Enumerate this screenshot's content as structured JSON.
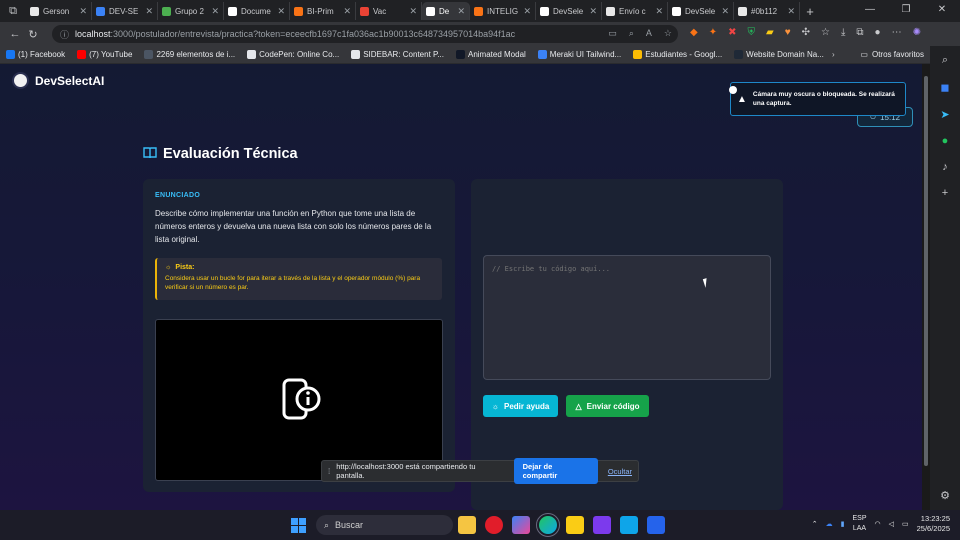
{
  "browser": {
    "tabs": [
      {
        "label": "Gerson",
        "color": "#e8e8e8"
      },
      {
        "label": "DEV-SE",
        "color": "#3b82f6"
      },
      {
        "label": "Grupo 2",
        "color": "#4caf50"
      },
      {
        "label": "Docume",
        "color": "#ffffff"
      },
      {
        "label": "BI-Prim",
        "color": "#f97316"
      },
      {
        "label": "Vac",
        "color": "#ea4335"
      },
      {
        "label": "De",
        "color": "#ffffff",
        "active": true
      },
      {
        "label": "INTELIG",
        "color": "#f97316"
      },
      {
        "label": "DevSele",
        "color": "#ffffff"
      },
      {
        "label": "Envío c",
        "color": "#e8e8e8"
      },
      {
        "label": "DevSele",
        "color": "#ffffff"
      },
      {
        "label": "#0b112",
        "color": "#e8e8e8"
      }
    ],
    "url_host": "localhost",
    "url_rest": ":3000/postulador/entrevista/practica?token=eceecfb1697c1fa036ac1b90013c648734957014ba94f1ac",
    "bookmarks": [
      {
        "label": "(1) Facebook",
        "color": "#1877f2"
      },
      {
        "label": "(7) YouTube",
        "color": "#ff0000"
      },
      {
        "label": "2269 elementos de i...",
        "color": "#4b5563"
      },
      {
        "label": "CodePen: Online Co...",
        "color": "#e5e7eb"
      },
      {
        "label": "SIDEBAR: Content P...",
        "color": "#e5e7eb"
      },
      {
        "label": "Animated Modal",
        "color": "#111827"
      },
      {
        "label": "Meraki UI Tailwind...",
        "color": "#3b82f6"
      },
      {
        "label": "Estudiantes - Googl...",
        "color": "#fbbc04"
      },
      {
        "label": "Website Domain Na...",
        "color": "#1f2937"
      }
    ],
    "other_bookmarks": "Otros favoritos"
  },
  "app": {
    "brand": "DevSelectAI",
    "timer": "15:12",
    "toast": "Cámara muy oscura o bloqueada. Se realizará una captura.",
    "heading": "Evaluación Técnica",
    "statement_label": "ENUNCIADO",
    "statement": "Describe cómo implementar una función en Python que tome una lista de números enteros y devuelva una nueva lista con solo los números pares de la lista original.",
    "hint_title": "Pista:",
    "hint_text": "Considera usar un bucle for para iterar a través de la lista y el operador módulo (%) para verificar si un número es par.",
    "code_placeholder": "// Escribe tu código aquí...",
    "help_button": "Pedir ayuda",
    "send_button": "Enviar código",
    "accent": "#38bdf8",
    "help_color": "#06b6d4",
    "send_color": "#16a34a"
  },
  "share_bar": {
    "message": "http://localhost:3000 está compartiendo tu pantalla.",
    "stop": "Dejar de compartir",
    "hide": "Ocultar"
  },
  "taskbar": {
    "search": "Buscar",
    "lang_top": "ESP",
    "lang_bottom": "LAA",
    "time": "13:23:25",
    "date": "25/6/2025"
  }
}
